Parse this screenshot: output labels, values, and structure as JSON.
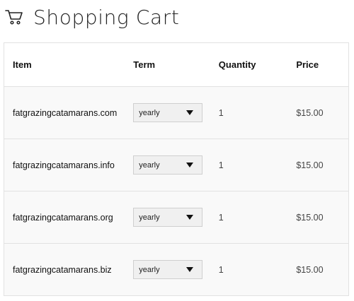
{
  "header": {
    "title": "Shopping Cart",
    "icon": "shopping-cart-icon"
  },
  "table": {
    "columns": {
      "item": "Item",
      "term": "Term",
      "quantity": "Quantity",
      "price": "Price"
    },
    "rows": [
      {
        "item": "fatgrazingcatamarans.com",
        "term": "yearly",
        "quantity": "1",
        "price": "$15.00"
      },
      {
        "item": "fatgrazingcatamarans.info",
        "term": "yearly",
        "quantity": "1",
        "price": "$15.00"
      },
      {
        "item": "fatgrazingcatamarans.org",
        "term": "yearly",
        "quantity": "1",
        "price": "$15.00"
      },
      {
        "item": "fatgrazingcatamarans.biz",
        "term": "yearly",
        "quantity": "1",
        "price": "$15.00"
      }
    ]
  },
  "colors": {
    "border": "#e2e2e2",
    "row_background": "#f9f9f9",
    "select_background": "#f0f0f0"
  }
}
